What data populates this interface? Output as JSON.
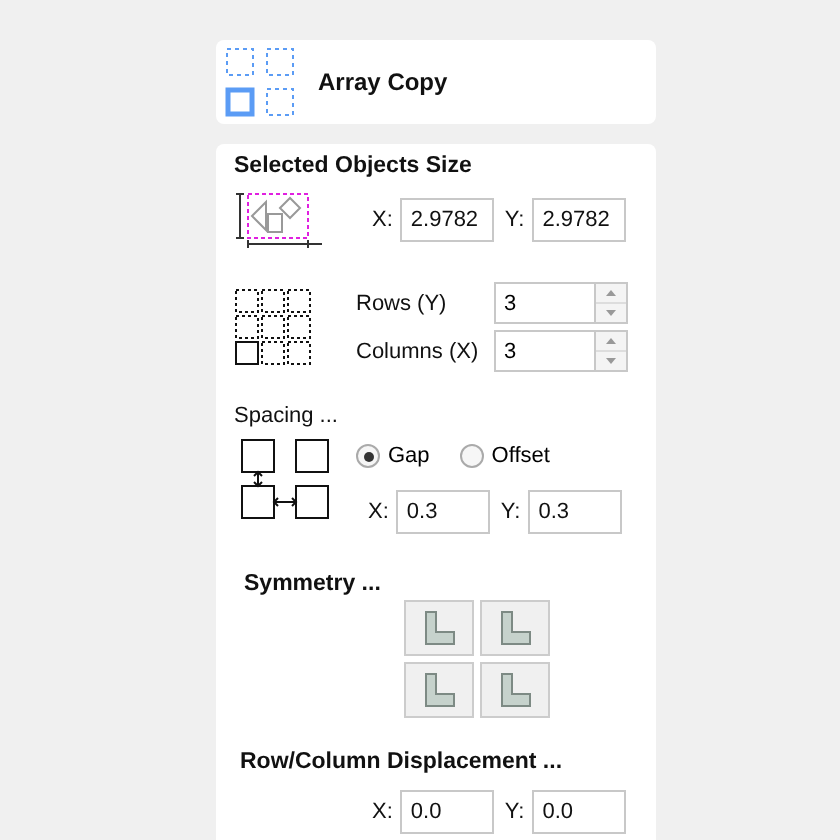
{
  "header": {
    "title": "Array Copy"
  },
  "size_section": {
    "title": "Selected Objects Size",
    "x_label": "X:",
    "x_value": "2.9782",
    "y_label": "Y:",
    "y_value": "2.9782"
  },
  "grid": {
    "rows_label": "Rows (Y)",
    "rows_value": "3",
    "columns_label": "Columns (X)",
    "columns_value": "3"
  },
  "spacing": {
    "title": "Spacing ...",
    "modes": [
      {
        "label": "Gap",
        "selected": true
      },
      {
        "label": "Offset",
        "selected": false
      }
    ],
    "x_label": "X:",
    "x_value": "0.3",
    "y_label": "Y:",
    "y_value": "0.3"
  },
  "symmetry": {
    "title": "Symmetry ..."
  },
  "displacement": {
    "title": "Row/Column Displacement ...",
    "x_label": "X:",
    "x_value": "0.0",
    "y_label": "Y:",
    "y_value": "0.0"
  }
}
